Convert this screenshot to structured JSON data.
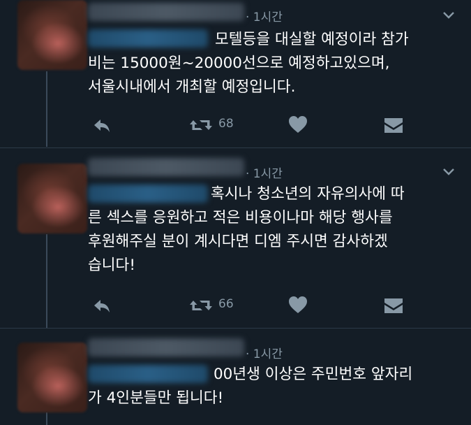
{
  "tweets": [
    {
      "time": "· 1시간",
      "text": "모텔등을 대실할 예정이라 참가\n비는 15000원~20000선으로 예정하고있으며,\n서울시내에서 개최할 예정입니다.",
      "retweet_count": "68"
    },
    {
      "time": "· 1시간",
      "text": "혹시나 청소년의 자유의사에 따\n른 섹스를 응원하고 적은 비용이나마 해당 행사를\n후원해주실 분이 계시다면 디엠 주시면 감사하겠\n습니다!",
      "retweet_count": "66"
    },
    {
      "time": "· 1시간",
      "text": "00년생 이상은 주민번호 앞자리\n가 4인분들만 됩니다!",
      "retweet_count": ""
    }
  ],
  "icons": {
    "reply": "reply-icon",
    "retweet": "retweet-icon",
    "like": "heart-icon",
    "dm": "envelope-icon",
    "more": "chevron-down-icon"
  },
  "colors": {
    "background": "#141d26",
    "text": "#ffffff",
    "muted": "#8899a6",
    "divider": "#2c3a47"
  }
}
